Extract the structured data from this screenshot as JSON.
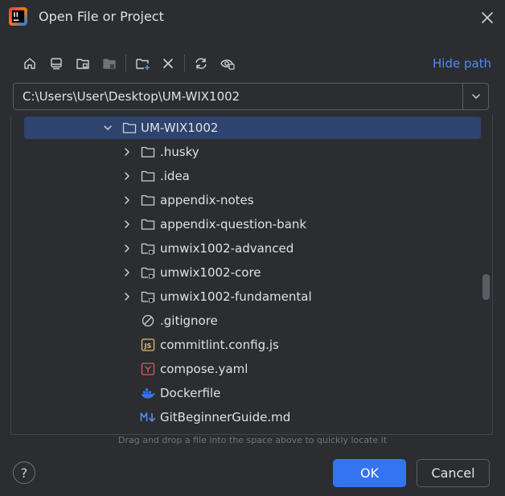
{
  "dialog": {
    "title": "Open File or Project"
  },
  "toolbar": {
    "buttons": [
      "home-icon",
      "desktop-icon",
      "project-directory-icon",
      "module-directory-icon",
      "new-folder-icon",
      "delete-icon",
      "refresh-icon",
      "show-hidden-icon"
    ],
    "hide_path_label": "Hide path"
  },
  "path": {
    "value": "C:\\Users\\User\\Desktop\\UM-WIX1002"
  },
  "tree": {
    "items": [
      {
        "label": "UM-WIX1002",
        "kind": "folder",
        "expanded": true,
        "selected": true
      },
      {
        "label": ".husky",
        "kind": "folder"
      },
      {
        "label": ".idea",
        "kind": "folder"
      },
      {
        "label": "appendix-notes",
        "kind": "folder"
      },
      {
        "label": "appendix-question-bank",
        "kind": "folder"
      },
      {
        "label": "umwix1002-advanced",
        "kind": "module-folder"
      },
      {
        "label": "umwix1002-core",
        "kind": "module-folder"
      },
      {
        "label": "umwix1002-fundamental",
        "kind": "module-folder"
      },
      {
        "label": ".gitignore",
        "kind": "ignore-file"
      },
      {
        "label": "commitlint.config.js",
        "kind": "js-file"
      },
      {
        "label": "compose.yaml",
        "kind": "yaml-file"
      },
      {
        "label": "Dockerfile",
        "kind": "docker-file"
      },
      {
        "label": "GitBeginnerGuide.md",
        "kind": "markdown-file"
      }
    ]
  },
  "hint": "Drag and drop a file into the space above to quickly locate it",
  "buttons": {
    "help": "?",
    "ok": "OK",
    "cancel": "Cancel"
  },
  "colors": {
    "background": "#2b2d30",
    "selection": "#2e436e",
    "accent": "#3574f0",
    "link": "#548af7"
  }
}
